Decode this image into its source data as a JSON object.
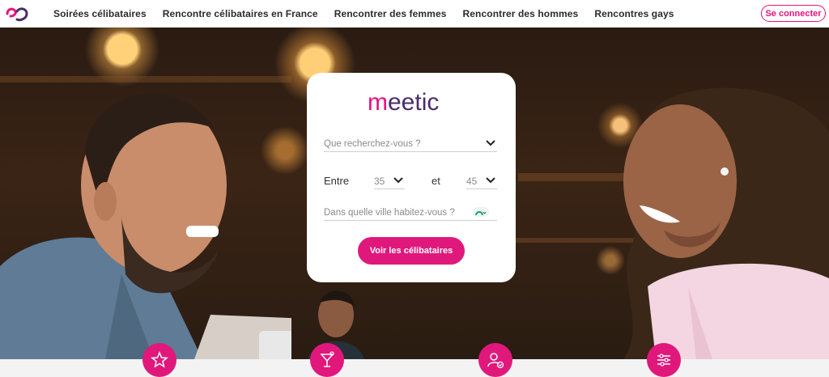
{
  "header": {
    "logo": "meetic-logo-icon",
    "nav": [
      "Soirées célibataires",
      "Rencontre célibataires en France",
      "Rencontrer des femmes",
      "Rencontrer des hommes",
      "Rencontres gays"
    ],
    "login_label": "Se connecter"
  },
  "search": {
    "brand": "meetic",
    "looking_for_placeholder": "Que recherchez-vous ?",
    "between_label": "Entre",
    "age_min": "35",
    "and_label": "et",
    "age_max": "45",
    "city_placeholder": "Dans quelle ville habitez-vous ?",
    "submit_label": "Voir les célibataires"
  },
  "features": [
    "party-star-icon",
    "cocktail-icon",
    "verified-user-icon",
    "filters-icon"
  ],
  "colors": {
    "accent": "#e0187c",
    "brand_dark": "#4a2d6b"
  }
}
